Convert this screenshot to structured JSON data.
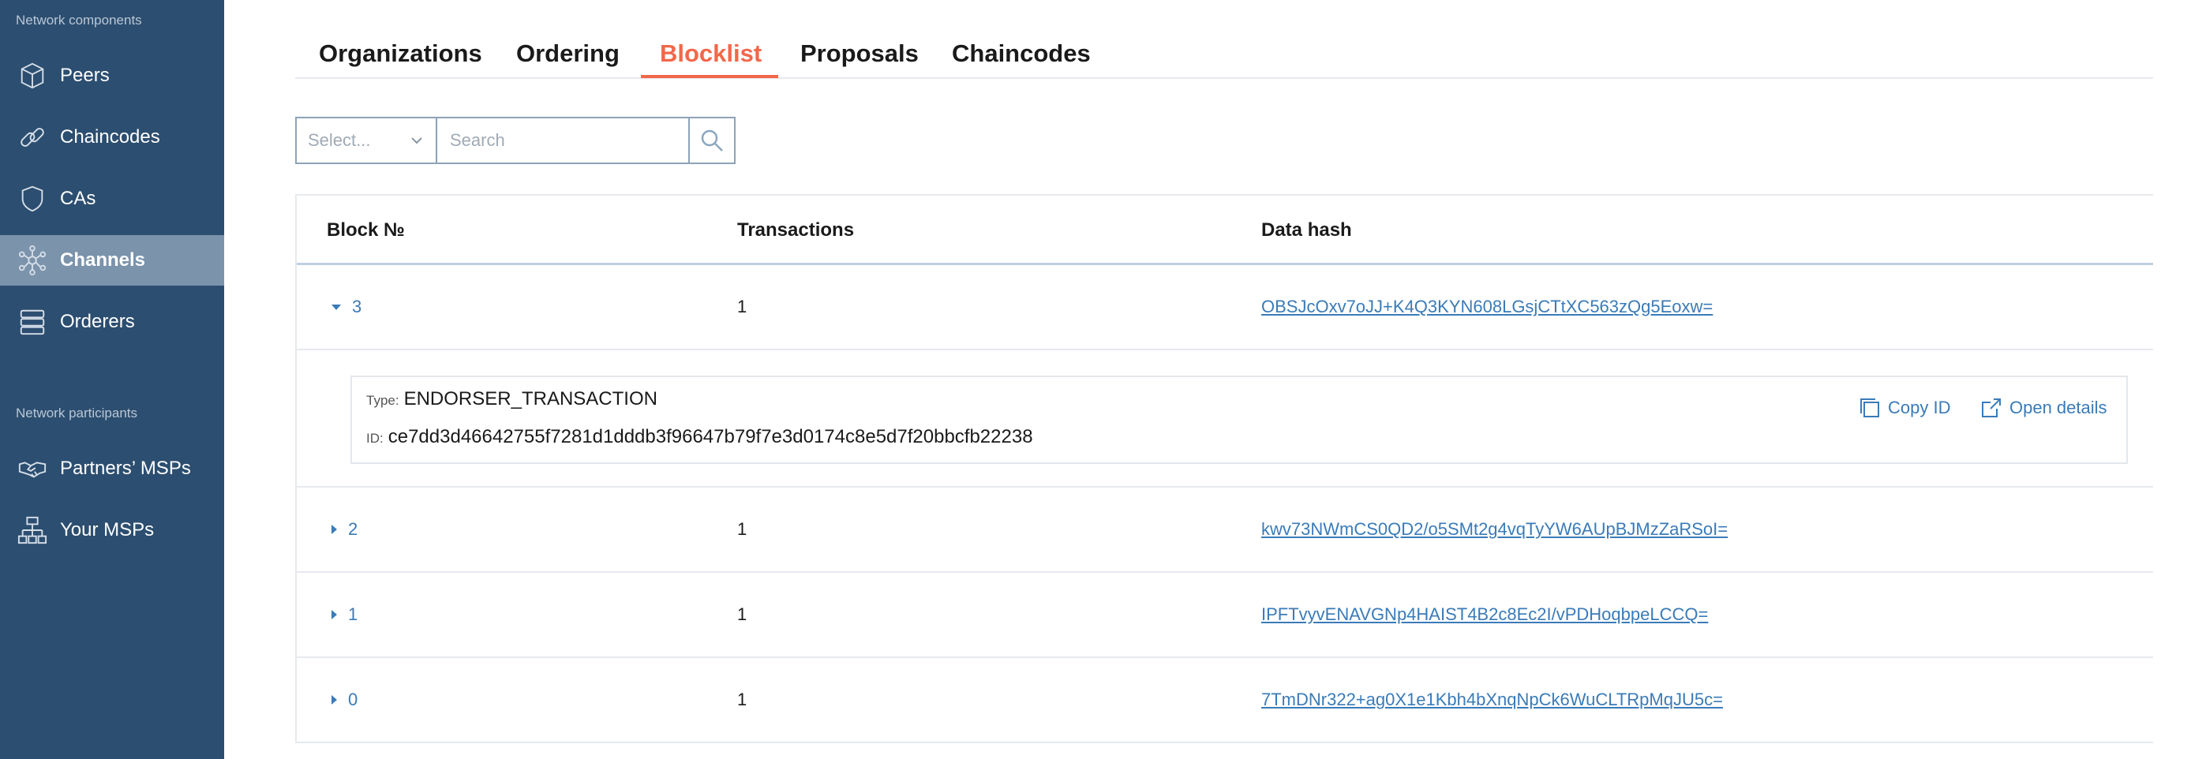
{
  "sidebar": {
    "components_title": "Network components",
    "participants_title": "Network participants",
    "items": [
      {
        "label": "Peers",
        "icon": "cube-icon"
      },
      {
        "label": "Chaincodes",
        "icon": "link-icon"
      },
      {
        "label": "CAs",
        "icon": "shield-icon"
      },
      {
        "label": "Channels",
        "icon": "network-icon",
        "active": true
      },
      {
        "label": "Orderers",
        "icon": "server-stack-icon"
      }
    ],
    "participants": [
      {
        "label": "Partners’ MSPs",
        "icon": "handshake-icon"
      },
      {
        "label": "Your MSPs",
        "icon": "org-chart-icon"
      }
    ]
  },
  "tabs": [
    {
      "label": "Organizations"
    },
    {
      "label": "Ordering"
    },
    {
      "label": "Blocklist",
      "active": true
    },
    {
      "label": "Proposals"
    },
    {
      "label": "Chaincodes"
    }
  ],
  "filter": {
    "select_placeholder": "Select...",
    "search_placeholder": "Search"
  },
  "table": {
    "headers": {
      "block": "Block №",
      "transactions": "Transactions",
      "hash": "Data hash"
    },
    "rows": [
      {
        "block": "3",
        "transactions": "1",
        "hash": "OBSJcOxv7oJJ+K4Q3KYN608LGsjCTtXC563zQg5Eoxw=",
        "expanded": true
      },
      {
        "block": "2",
        "transactions": "1",
        "hash": "kwv73NWmCS0QD2/o5SMt2g4vqTyYW6AUpBJMzZaRSoI="
      },
      {
        "block": "1",
        "transactions": "1",
        "hash": "IPFTvyvENAVGNp4HAIST4B2c8Ec2I/vPDHoqbpeLCCQ="
      },
      {
        "block": "0",
        "transactions": "1",
        "hash": "7TmDNr322+ag0X1e1Kbh4bXnqNpCk6WuCLTRpMqJU5c="
      }
    ],
    "transaction": {
      "type_key": "Type:",
      "type_value": "ENDORSER_TRANSACTION",
      "id_key": "ID:",
      "id_value": "ce7dd3d46642755f7281d1dddb3f96647b79f7e3d0174c8e5d7f20bbcfb22238",
      "copy_label": "Copy ID",
      "open_label": "Open details"
    }
  },
  "colors": {
    "sidebar_bg": "#2c4e70",
    "active_item": "#7b93ab",
    "accent": "#f2674a",
    "link": "#3a7bb8"
  }
}
